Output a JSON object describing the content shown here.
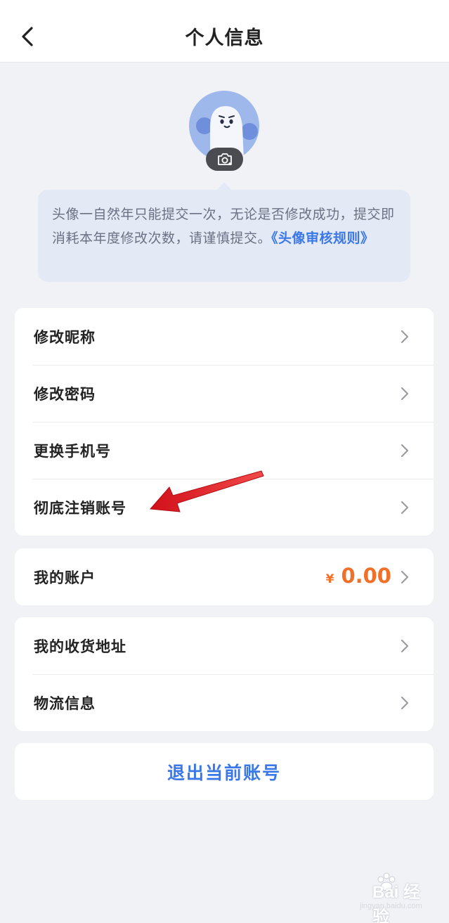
{
  "nav": {
    "title": "个人信息"
  },
  "notice": {
    "text": "头像一自然年只能提交一次，无论是否修改成功，提交即消耗本年度修改次数，请谨慎提交。",
    "link": "《头像审核规则》"
  },
  "card1": {
    "items": [
      {
        "label": "修改昵称"
      },
      {
        "label": "修改密码"
      },
      {
        "label": "更换手机号"
      },
      {
        "label": "彻底注销账号"
      }
    ]
  },
  "account": {
    "label": "我的账户",
    "currency": "¥",
    "balance": "0.00"
  },
  "card3": {
    "items": [
      {
        "label": "我的收货地址"
      },
      {
        "label": "物流信息"
      }
    ]
  },
  "logout": {
    "label": "退出当前账号"
  },
  "watermark": {
    "text": "Bai 经验",
    "sub": "jingyan.baidu.com"
  },
  "colors": {
    "accent": "#3b78e7",
    "balance": "#f0702a",
    "annotation_arrow": "#e11e1e"
  }
}
